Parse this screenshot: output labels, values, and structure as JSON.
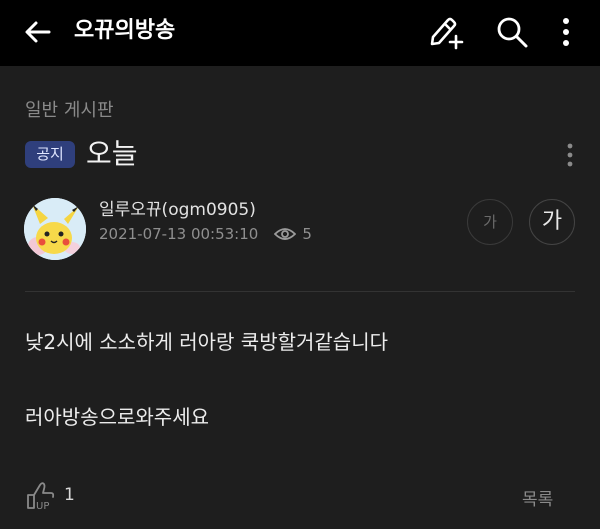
{
  "header": {
    "title": "오뀨의방송",
    "icons": [
      "back-arrow-icon",
      "write-post-icon",
      "search-icon",
      "more-vertical-icon"
    ]
  },
  "board": {
    "name": "일반 게시판"
  },
  "post": {
    "badge": "공지",
    "title": "오늘",
    "author": "일루오뀨(ogm0905)",
    "datetime": "2021-07-13 00:53:10",
    "views": "5",
    "font_small": "가",
    "font_large": "가",
    "body": [
      "낮2시에 소소하게 러아랑 쿡방할거같습니다",
      "러아방송으로와주세요"
    ]
  },
  "footer": {
    "like_icon_text": "UP",
    "like_count": "1",
    "list_label": "목록"
  },
  "colors": {
    "background": "#1e1e1e",
    "header": "#000000",
    "badge": "#2f3f7c"
  }
}
